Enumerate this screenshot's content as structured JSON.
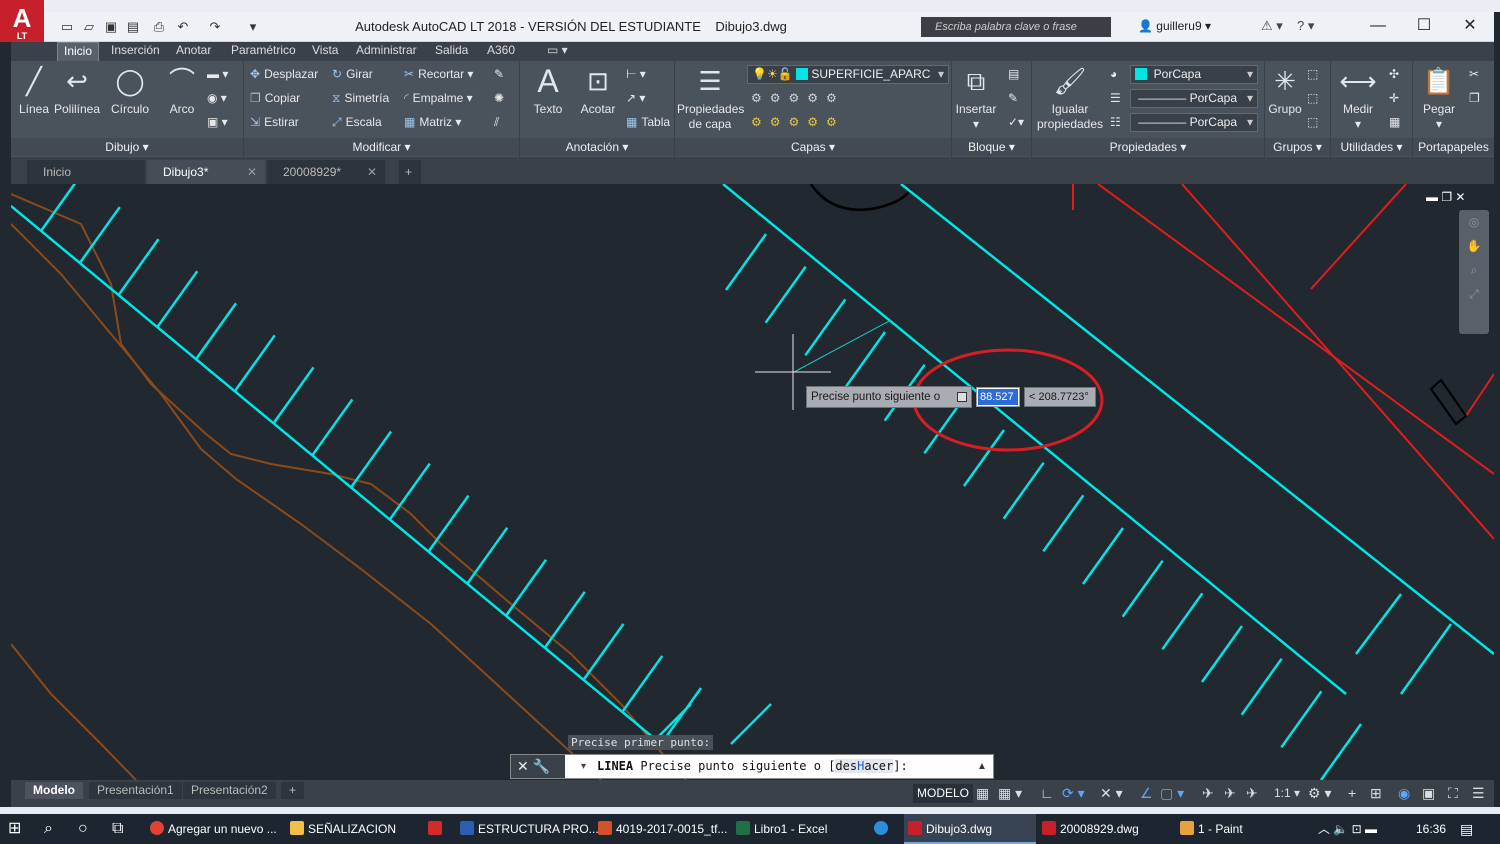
{
  "window": {
    "title": "Autodesk AutoCAD LT 2018 - VERSIÓN DEL ESTUDIANTE    Dibujo3.dwg",
    "search_placeholder": "Escriba palabra clave o frase",
    "user": "guilleru9",
    "logo": "A",
    "logo_sub": "LT"
  },
  "ribbon_tabs": [
    "Inicio",
    "Inserción",
    "Anotar",
    "Paramétrico",
    "Vista",
    "Administrar",
    "Salida",
    "A360"
  ],
  "ribbon": {
    "dibujo": {
      "title": "Dibujo",
      "items": [
        "Línea",
        "Polilínea",
        "Círculo",
        "Arco"
      ]
    },
    "modificar": {
      "title": "Modificar",
      "items": [
        "Desplazar",
        "Girar",
        "Recortar",
        "Copiar",
        "Simetría",
        "Empalme",
        "Estirar",
        "Escala",
        "Matriz"
      ]
    },
    "anotacion": {
      "title": "Anotación",
      "items": [
        "Texto",
        "Acotar",
        "Tabla"
      ]
    },
    "capas": {
      "title": "Capas",
      "props": "Propiedades\nde capa",
      "layer": "SUPERFICIE_APARC"
    },
    "bloque": {
      "title": "Bloque",
      "insert": "Insertar"
    },
    "propiedades": {
      "title": "Propiedades",
      "match": "Igualar\npropiedades",
      "color": "PorCapa",
      "linetype": "PorCapa",
      "lineweight": "PorCapa"
    },
    "grupos": {
      "title": "Grupos",
      "item": "Grupo"
    },
    "utilidades": {
      "title": "Utilidades",
      "item": "Medir"
    },
    "portapapeles": {
      "title": "Portapapeles",
      "item": "Pegar"
    }
  },
  "doc_tabs": [
    "Inicio",
    "Dibujo3*",
    "20008929*"
  ],
  "layout_tabs": [
    "Modelo",
    "Presentación1",
    "Presentación2"
  ],
  "status": {
    "mode": "MODELO",
    "scale": "1:1"
  },
  "command": {
    "history": "Precise primer punto:",
    "current_cmd": "LINEA",
    "current_prompt": " Precise punto siguiente o [",
    "option_pre": "des",
    "option_key": "H",
    "option_post": "acer",
    "tail": "]:"
  },
  "dynamic_input": {
    "prompt": "Precise punto siguiente o",
    "length": "88.527",
    "angle": "< 208.7723°"
  },
  "taskbar": {
    "items": [
      "Agregar un nuevo ...",
      "SEÑALIZACION",
      "",
      "ESTRUCTURA PRO...",
      "4019-2017-0015_tf...",
      "Libro1 - Excel",
      "",
      "Dibujo3.dwg",
      "20008929.dwg",
      "1 - Paint"
    ],
    "time": "16:36"
  },
  "colors": {
    "parking": "#00e5e5",
    "red": "#e11d1d",
    "brown": "#8a4a1c",
    "highlight": "#d81e22"
  }
}
